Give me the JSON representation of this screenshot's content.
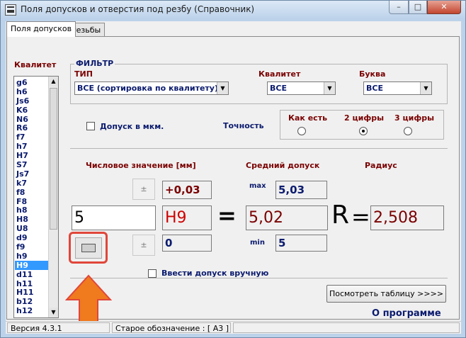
{
  "window": {
    "title": "Поля допусков и отверстия под резбу (Справочник)",
    "min_glyph": "–",
    "max_glyph": "□",
    "close_glyph": "✕"
  },
  "tabs": [
    {
      "label": "Поля допусков"
    },
    {
      "label": "Резьбы"
    }
  ],
  "kvalitet_list": {
    "label": "Квалитет",
    "items": [
      "g6",
      "h6",
      "Js6",
      "K6",
      "N6",
      "R6",
      "f7",
      "h7",
      "H7",
      "S7",
      "Js7",
      "k7",
      "f8",
      "F8",
      "h8",
      "H8",
      "U8",
      "d9",
      "f9",
      "h9",
      "H9",
      "d11",
      "h11",
      "H11",
      "b12",
      "h12"
    ],
    "selected": "H9",
    "up_glyph": "▲",
    "down_glyph": "▼"
  },
  "filter": {
    "legend": "ФИЛЬТР",
    "type_label": "ТИП",
    "type_value": "ВСЕ (сортировка по квалитету)",
    "kvalitet_label": "Квалитет",
    "kvalitet_value": "ВСЕ",
    "letter_label": "Буква",
    "letter_value": "ВСЕ",
    "arrow_glyph": "▼"
  },
  "options": {
    "microns_label": "Допуск в мкм.",
    "precision_label": "Точность",
    "precision_options": [
      "Как есть",
      "2 цифры",
      "3 цифры"
    ],
    "precision_selected": "2 цифры"
  },
  "calc": {
    "numeric_label": "Числовое значение [мм]",
    "avg_label": "Средний допуск",
    "radius_label": "Радиус",
    "plus_minus": "±",
    "upper_dev": "+0,03",
    "lower_dev": "0",
    "max_label": "max",
    "max_value": "5,03",
    "min_label": "min",
    "min_value": "5",
    "input_value": "5",
    "field_code": "H9",
    "equals": "=",
    "average": "5,02",
    "r_letter": "R",
    "radius": "2,508",
    "manual_label": "Ввести допуск вручную"
  },
  "actions": {
    "view_table": "Посмотреть таблицу >>>>",
    "about": "О программе"
  },
  "status": {
    "version": "Версия 4.3.1",
    "old_designation": "Старое обозначение :  [ А3 ]"
  },
  "colors": {
    "accent_red": "#7a0000",
    "accent_navy": "#0b1b6e",
    "highlight": "#e0463a",
    "arrow": "#f07a1e",
    "selection": "#3399ff"
  }
}
